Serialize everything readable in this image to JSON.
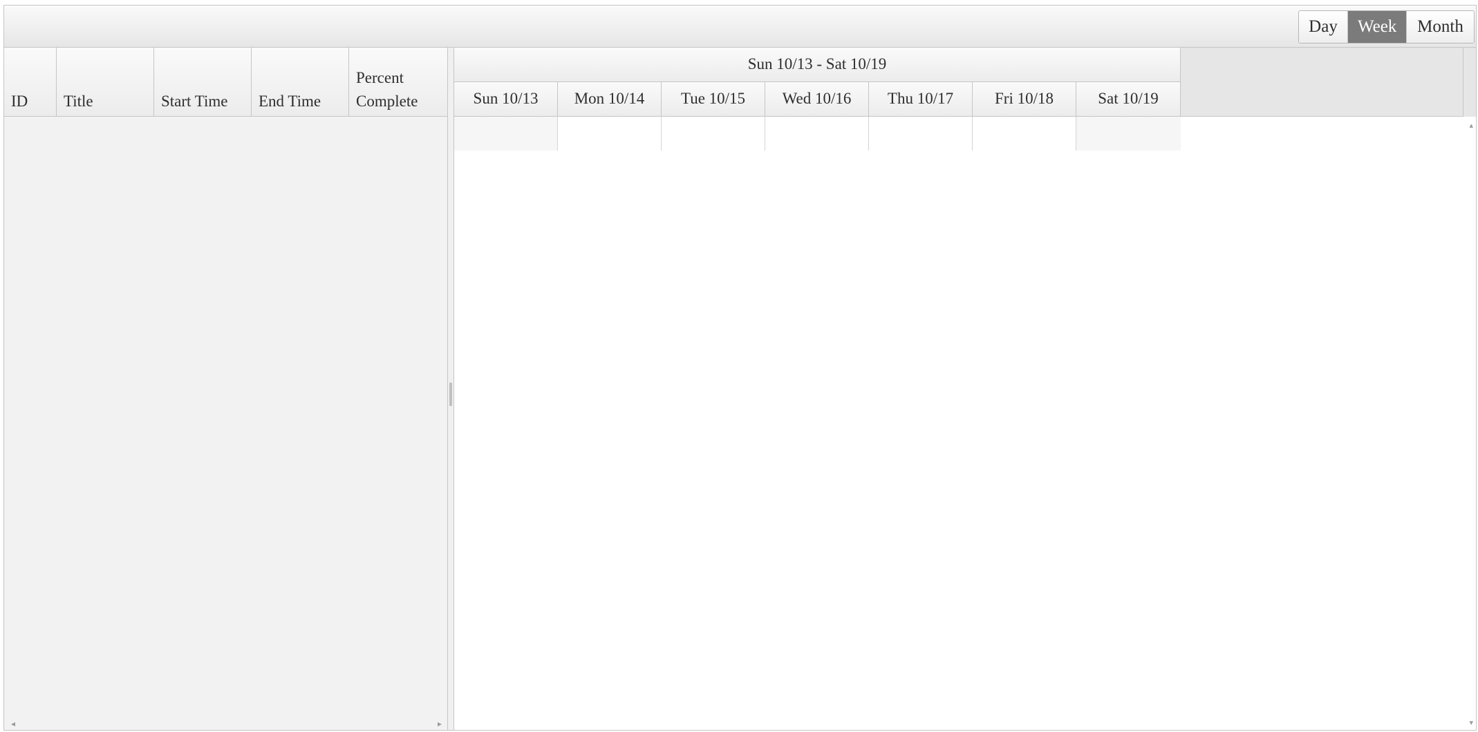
{
  "toolbar": {
    "views": [
      {
        "label": "Day",
        "selected": false
      },
      {
        "label": "Week",
        "selected": true
      },
      {
        "label": "Month",
        "selected": false
      }
    ]
  },
  "grid": {
    "columns": [
      {
        "label": "ID"
      },
      {
        "label": "Title"
      },
      {
        "label": "Start Time"
      },
      {
        "label": "End Time"
      },
      {
        "label": "Percent\nComplete"
      }
    ]
  },
  "timeline": {
    "range_label": "Sun 10/13 - Sat 10/19",
    "days": [
      {
        "label": "Sun 10/13",
        "weekend": true
      },
      {
        "label": "Mon 10/14",
        "weekend": false
      },
      {
        "label": "Tue 10/15",
        "weekend": false
      },
      {
        "label": "Wed 10/16",
        "weekend": false
      },
      {
        "label": "Thu 10/17",
        "weekend": false
      },
      {
        "label": "Fri 10/18",
        "weekend": false
      },
      {
        "label": "Sat 10/19",
        "weekend": true
      }
    ]
  },
  "icons": {
    "scroll_left": "◂",
    "scroll_right": "▸",
    "scroll_up": "▴",
    "scroll_down": "▾"
  }
}
